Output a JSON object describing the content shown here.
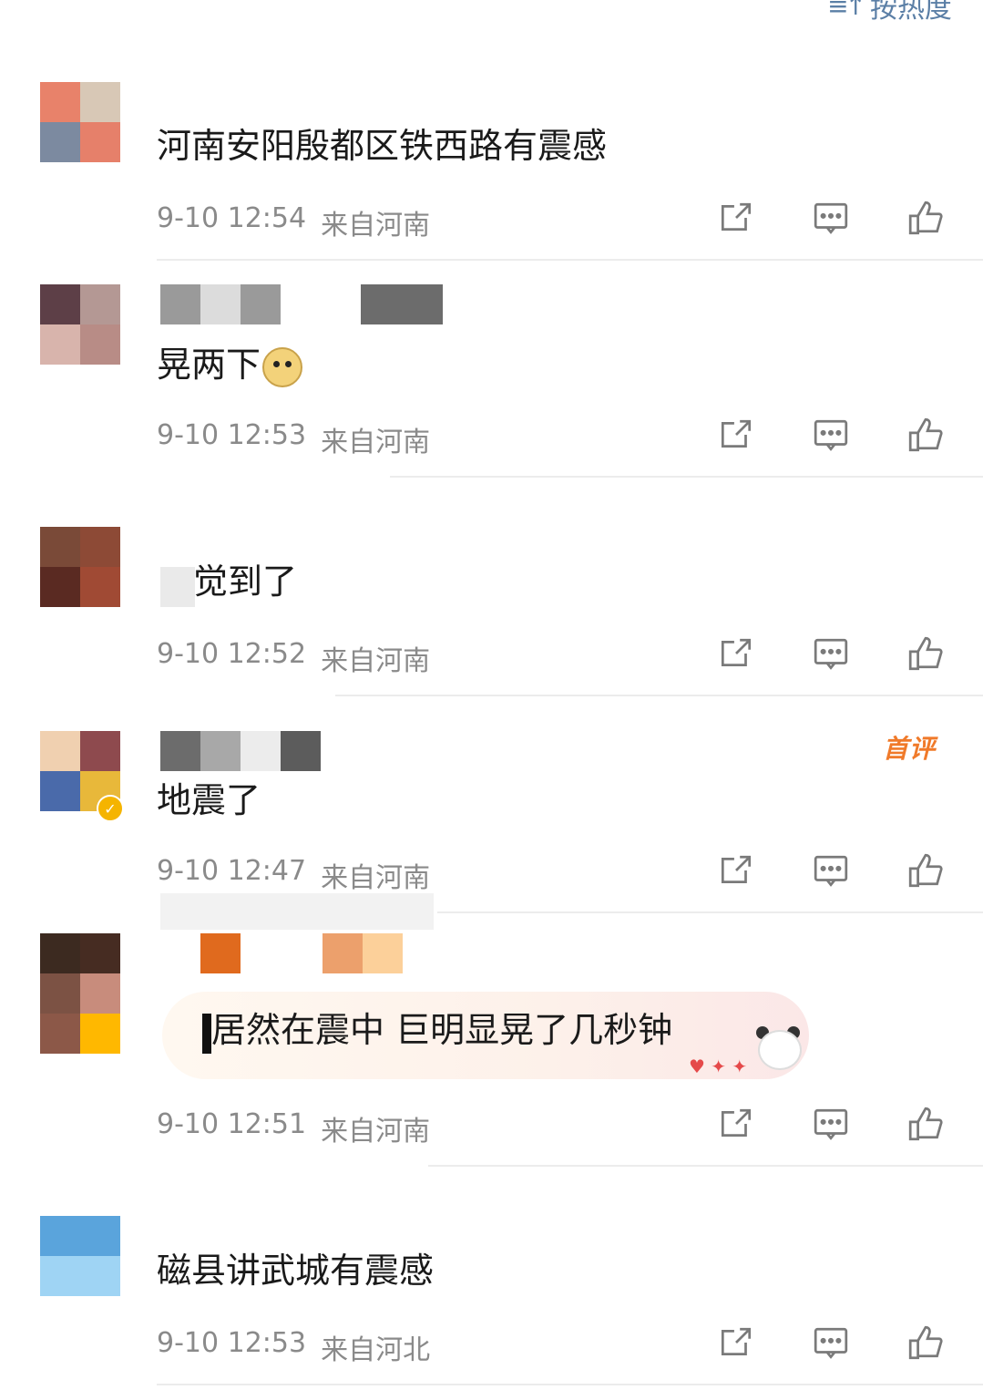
{
  "sort": {
    "label": "按热度"
  },
  "comments": [
    {
      "content": "河南安阳殷都区铁西路有震感",
      "date": "9-10 12:54",
      "location": "来自河南",
      "avatar_colors": [
        "#e8826a",
        "#d8c8b6",
        "#7c8aa0",
        "#e6806a"
      ]
    },
    {
      "content": "晃两下",
      "emoji": "dog-emoji",
      "date": "9-10 12:53",
      "location": "来自河南",
      "avatar_colors": [
        "#5d3f47",
        "#b49894",
        "#d8b4ac",
        "#b88c86"
      ]
    },
    {
      "content": "觉到了",
      "date": "9-10 12:52",
      "location": "来自河南",
      "avatar_colors": [
        "#7a4a38",
        "#8d4a36",
        "#5a2a22",
        "#a04a34"
      ]
    },
    {
      "content": "地震了",
      "badge": "首评",
      "date": "9-10 12:47",
      "location": "来自河南",
      "avatar_colors": [
        "#f0d0b0",
        "#8e4a4e",
        "#4a6aaa",
        "#e8b83a"
      ]
    },
    {
      "content": "居然在震中 巨明显晃了几秒钟",
      "date": "9-10 12:51",
      "location": "来自河南",
      "avatar_colors": [
        "#3c2a20",
        "#462c22",
        "#7c5244",
        "#c88c7c",
        "#8c5848",
        "#ffb800"
      ]
    },
    {
      "content": "磁县讲武城有震感",
      "date": "9-10 12:53",
      "location": "来自河北",
      "avatar_colors": [
        "#5aa4dc",
        "#5aa4dc",
        "#9fd4f4",
        "#9fd4f4"
      ]
    }
  ],
  "icons": {
    "share": "share-icon",
    "comment": "comment-icon",
    "like": "like-icon"
  },
  "colors": {
    "meta": "#8a8a8a",
    "badge": "#f07a2a",
    "sort": "#5b7fa6"
  }
}
